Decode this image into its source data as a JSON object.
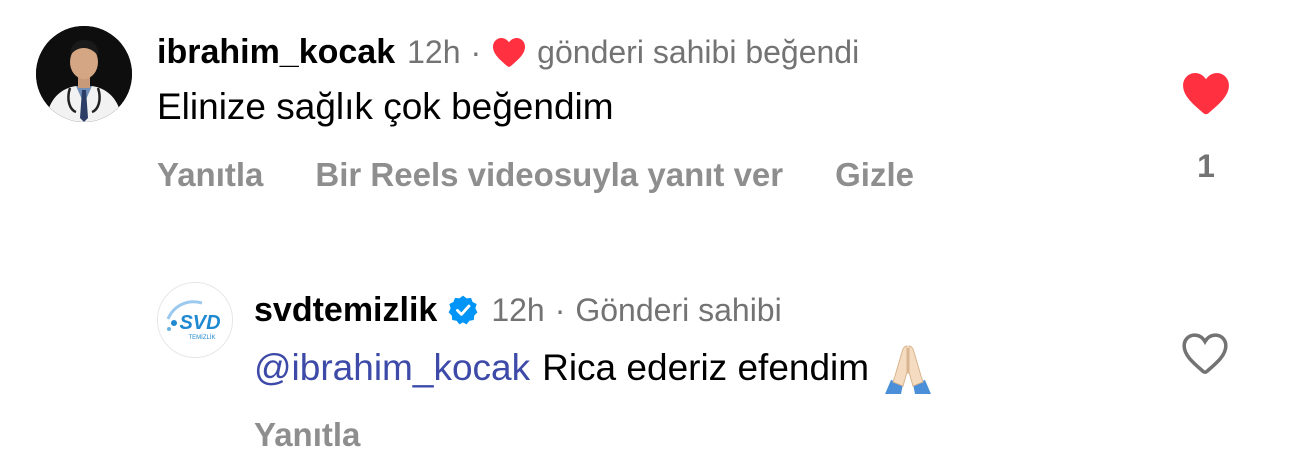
{
  "comment": {
    "username": "ibrahim_kocak",
    "time": "12h",
    "separator": "·",
    "liked_by_author": "gönderi sahibi beğendi",
    "text": "Elinize sağlık çok beğendim",
    "actions": {
      "reply": "Yanıtla",
      "reels_reply": "Bir Reels videosuyla yanıt ver",
      "hide": "Gizle"
    },
    "like_count": "1",
    "liked": true
  },
  "reply": {
    "username": "svdtemizlik",
    "verified": true,
    "time": "12h",
    "separator": "·",
    "author_label": "Gönderi sahibi",
    "mention": "@ibrahim_kocak",
    "text": "Rica ederiz efendim",
    "emoji": "folded-hands",
    "actions": {
      "reply": "Yanıtla"
    },
    "liked": false
  },
  "logo": {
    "text": "SVD",
    "subtext": "TEMİZLİK"
  },
  "colors": {
    "heart_red": "#ff3040",
    "meta_gray": "#737373",
    "action_gray": "#8e8e8e",
    "mention_blue": "#3d4aa8",
    "verified_blue": "#0095f6",
    "logo_blue": "#1e88d0"
  },
  "icons": {
    "liked_heart": "heart-filled-icon",
    "like_button": "heart-filled-icon",
    "reply_like_button": "heart-outline-icon",
    "verified": "verified-badge-icon"
  }
}
